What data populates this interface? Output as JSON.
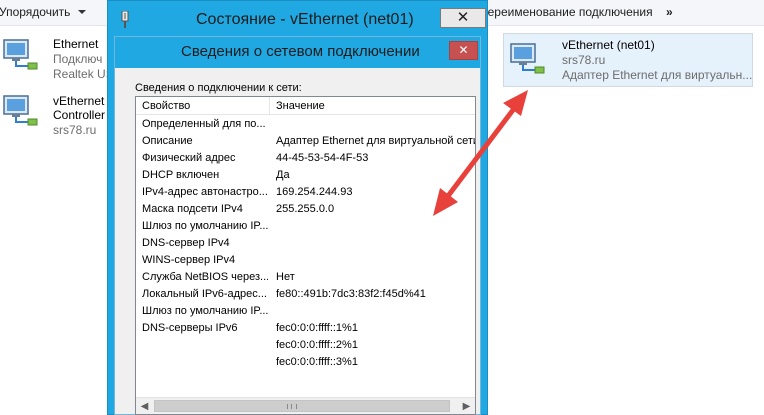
{
  "toolbar": {
    "organize_label": "Упорядочить",
    "rename_label": "Переименование подключения",
    "more_label": "»"
  },
  "connections": [
    {
      "name": "Ethernet",
      "status": "Подключ",
      "device": "Realtek US"
    },
    {
      "name": "vEthernet",
      "status": "Controller",
      "device": "srs78.ru"
    }
  ],
  "selected_connection": {
    "name": "vEthernet (net01)",
    "network": "srs78.ru",
    "device": "Адаптер Ethernet для виртуальн..."
  },
  "status_window": {
    "title": "Состояние - vEthernet (net01)",
    "close_label": "✕"
  },
  "details_window": {
    "title": "Сведения о сетевом подключении",
    "close_label": "✕",
    "section_label": "Сведения о подключении к сети:",
    "columns": [
      "Свойство",
      "Значение"
    ],
    "rows": [
      [
        "Определенный для по...",
        ""
      ],
      [
        "Описание",
        "Адаптер Ethernet для виртуальной сети"
      ],
      [
        "Физический адрес",
        "44-45-53-54-4F-53"
      ],
      [
        "DHCP включен",
        "Да"
      ],
      [
        "IPv4-адрес автонастро...",
        "169.254.244.93"
      ],
      [
        "Маска подсети IPv4",
        "255.255.0.0"
      ],
      [
        "Шлюз по умолчанию IP...",
        ""
      ],
      [
        "DNS-сервер IPv4",
        ""
      ],
      [
        "WINS-сервер IPv4",
        ""
      ],
      [
        "Служба NetBIOS через...",
        "Нет"
      ],
      [
        "Локальный IPv6-адрес...",
        "fe80::491b:7dc3:83f2:f45d%41"
      ],
      [
        "Шлюз по умолчанию IP...",
        ""
      ],
      [
        "DNS-серверы IPv6",
        "fec0:0:0:ffff::1%1"
      ],
      [
        "",
        "fec0:0:0:ffff::2%1"
      ],
      [
        "",
        "fec0:0:0:ffff::3%1"
      ]
    ],
    "scroll_left": "◀",
    "scroll_right": "▶"
  },
  "colors": {
    "window_frame": "#20a8e3",
    "annotation_arrow": "#e8413c",
    "selected_item": "#e5f1fb"
  }
}
